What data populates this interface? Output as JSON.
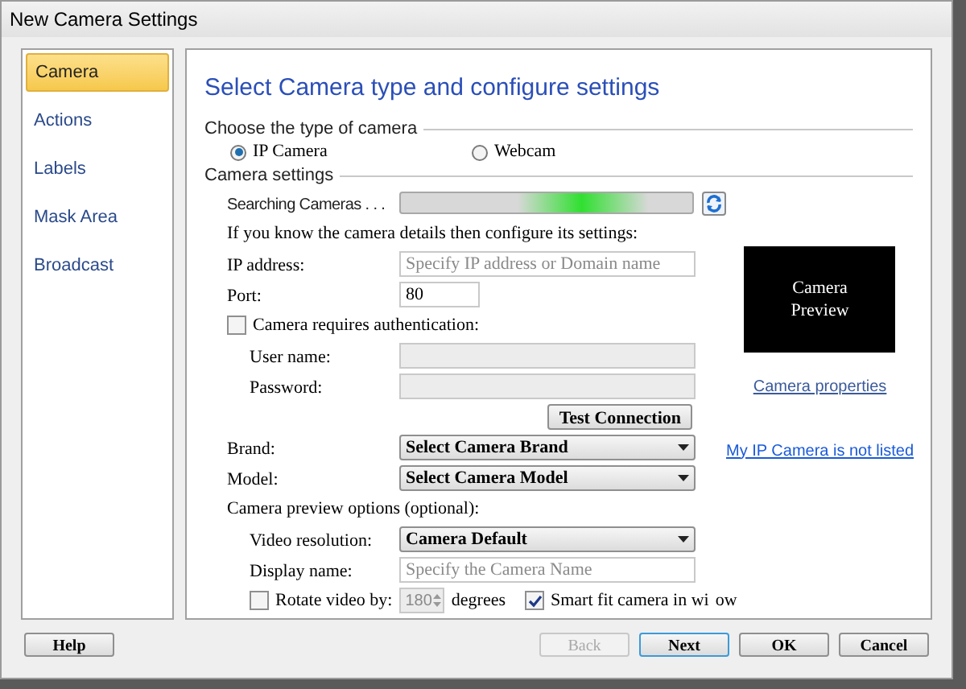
{
  "window": {
    "title": "New Camera Settings"
  },
  "sidebar": {
    "items": [
      {
        "label": "Camera",
        "selected": true
      },
      {
        "label": "Actions",
        "selected": false
      },
      {
        "label": "Labels",
        "selected": false
      },
      {
        "label": "Mask Area",
        "selected": false
      },
      {
        "label": "Broadcast",
        "selected": false
      }
    ]
  },
  "main": {
    "heading": "Select Camera type and configure settings",
    "camera_type": {
      "legend": "Choose the type of camera",
      "options": [
        {
          "label": "IP Camera",
          "selected": true
        },
        {
          "label": "Webcam",
          "selected": false
        }
      ]
    },
    "camera_settings": {
      "legend": "Camera settings",
      "search_label": "Searching Cameras . . .",
      "searching": true,
      "hint": "If you know the camera details then configure its settings:",
      "ip_address": {
        "label": "IP address:",
        "placeholder": "Specify IP address or Domain name"
      },
      "port": {
        "label": "Port:",
        "value": "80"
      },
      "auth": {
        "label": "Camera requires authentication:",
        "checked": false
      },
      "user_name": {
        "label": "User name:",
        "disabled": true
      },
      "password": {
        "label": "Password:",
        "disabled": true
      },
      "test_button": "Test Connection",
      "brand": {
        "label": "Brand:",
        "value": "Select Camera Brand"
      },
      "model": {
        "label": "Model:",
        "value": "Select Camera Model"
      }
    },
    "preview_options": {
      "label": "Camera preview options (optional):",
      "video_resolution": {
        "label": "Video resolution:",
        "value": "Camera Default"
      },
      "display_name": {
        "label": "Display name:",
        "placeholder": "Specify the Camera Name"
      },
      "rotate": {
        "label": "Rotate video by:",
        "checked": false,
        "value": "180",
        "disabled": true,
        "unit": "degrees"
      },
      "smart_fit": {
        "label": "Smart fit camera in wi",
        "label_after_icon": "ow",
        "checked": true
      }
    },
    "preview": {
      "line_1": "Camera",
      "line_2": "Preview"
    },
    "links": [
      "Camera properties",
      "My IP Camera is not listed"
    ]
  },
  "buttons": [
    {
      "label": "Help",
      "disabled": false,
      "default": false
    },
    {
      "label": "Back",
      "disabled": true,
      "default": false
    },
    {
      "label": "Next",
      "disabled": false,
      "default": true
    },
    {
      "label": "OK",
      "disabled": false,
      "default": false
    },
    {
      "label": "Cancel",
      "disabled": false,
      "default": false
    }
  ]
}
